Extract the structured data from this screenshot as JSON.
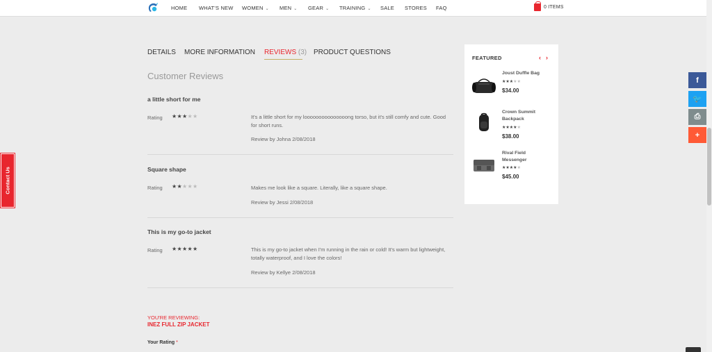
{
  "nav": {
    "items": [
      {
        "label": "HOME",
        "dropdown": false
      },
      {
        "label": "WHAT'S NEW",
        "dropdown": false
      },
      {
        "label": "WOMEN",
        "dropdown": true
      },
      {
        "label": "MEN",
        "dropdown": true
      },
      {
        "label": "GEAR",
        "dropdown": true
      },
      {
        "label": "TRAINING",
        "dropdown": true
      },
      {
        "label": "SALE",
        "dropdown": false
      },
      {
        "label": "STORES",
        "dropdown": false
      },
      {
        "label": "FAQ",
        "dropdown": false
      }
    ],
    "cart_label": "0 ITEMS",
    "logo_icon": "logo-icon",
    "cart_icon": "shopping-bag-icon"
  },
  "tabs": [
    {
      "label": "DETAILS",
      "active": false
    },
    {
      "label": "MORE INFORMATION",
      "active": false
    },
    {
      "label": "REVIEWS",
      "count": "(3)",
      "active": true
    },
    {
      "label": "PRODUCT QUESTIONS",
      "active": false
    }
  ],
  "reviews_section": {
    "title": "Customer Reviews",
    "rating_label": "Rating",
    "reviews": [
      {
        "title": "a little short for me",
        "rating": 3,
        "max": 5,
        "text": "It's a little short for my looooooooooooooong torso, but it's still comfy and cute. Good for short runs.",
        "by": "Review by Johna 2/08/2018"
      },
      {
        "title": "Square shape",
        "rating": 2,
        "max": 5,
        "text": "Makes me look like a square. Literally, like a square shape.",
        "by": "Review by Jessi 2/08/2018"
      },
      {
        "title": "This is my go-to jacket",
        "rating": 5,
        "max": 5,
        "text": "This is my go-to jacket when I'm running in the rain or cold! It's warm but lightweight, totally waterproof, and I love the colors!",
        "by": "Review by Kellye 2/08/2018"
      }
    ]
  },
  "review_form": {
    "youre_reviewing": "YOU'RE REVIEWING:",
    "product_name": "INEZ FULL ZIP JACKET",
    "your_rating_label": "Your Rating",
    "required_mark": "*"
  },
  "featured": {
    "title": "FEATURED",
    "prev_icon": "chevron-left-icon",
    "next_icon": "chevron-right-icon",
    "items": [
      {
        "name": "Joust Duffle Bag",
        "rating": 2.5,
        "price": "$34.00"
      },
      {
        "name": "Crown Summit Backpack",
        "rating": 3.5,
        "price": "$38.00"
      },
      {
        "name": "Rival Field Messenger",
        "rating": 3.5,
        "price": "$45.00"
      }
    ]
  },
  "social": [
    {
      "icon": "facebook-icon",
      "color": "#3b5998",
      "glyph": "f"
    },
    {
      "icon": "twitter-icon",
      "color": "#1da1f2",
      "glyph": "🐦"
    },
    {
      "icon": "print-icon",
      "color": "#7f8c8d",
      "glyph": "⎙"
    },
    {
      "icon": "share-plus-icon",
      "color": "#ff5a36",
      "glyph": "+"
    }
  ],
  "contact_tab": {
    "label": "Contact Us"
  },
  "colors": {
    "accent": "#e8262e",
    "tab_underline": "#c2b064"
  }
}
